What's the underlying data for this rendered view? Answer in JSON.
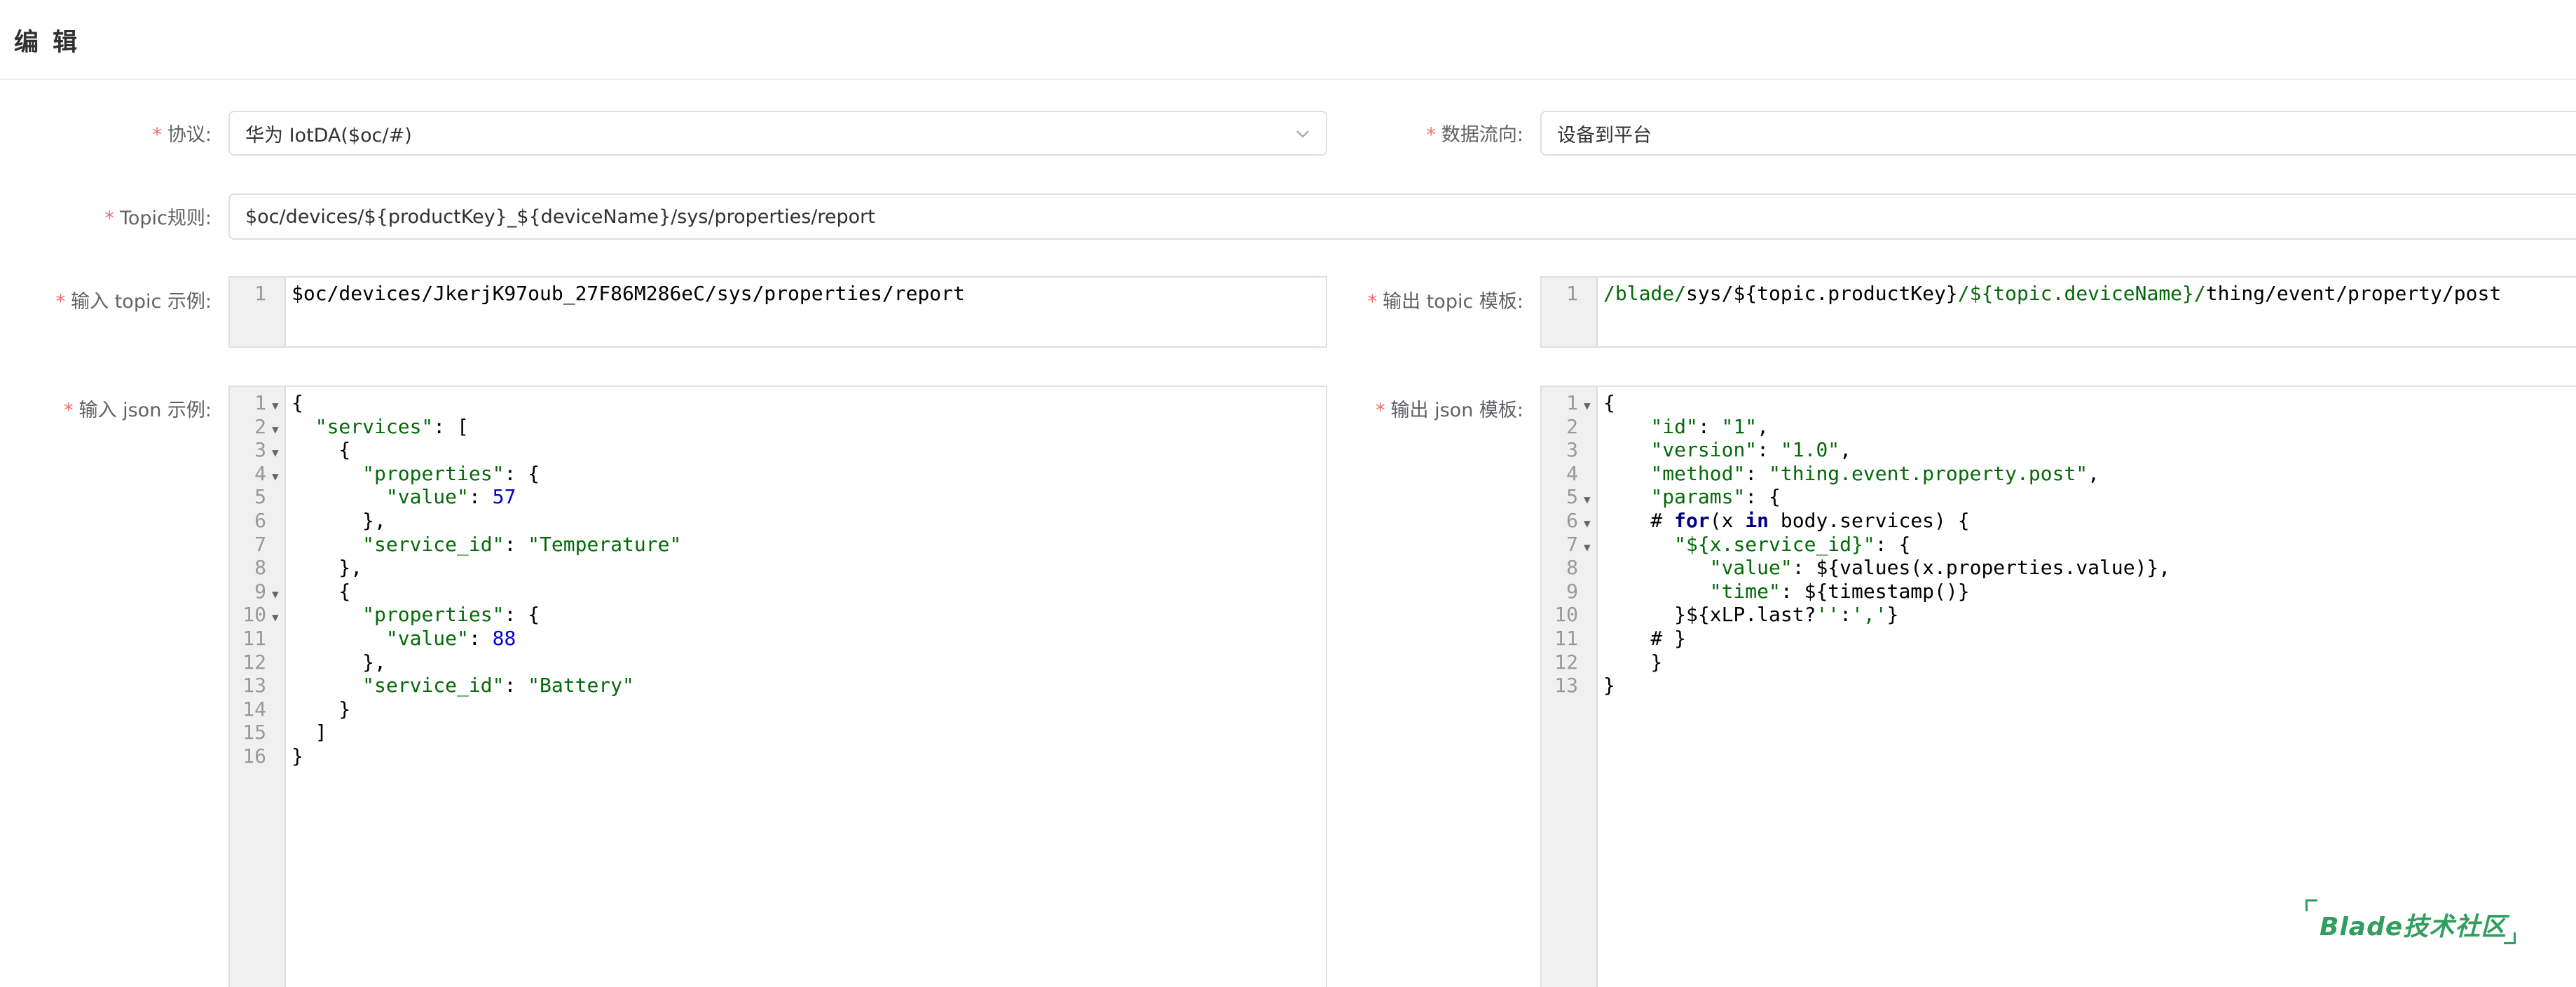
{
  "dialog": {
    "title": "编 辑"
  },
  "form": {
    "protocol": {
      "label": "协议:",
      "value": "华为 IotDA($oc/#)"
    },
    "flow": {
      "label": "数据流向:",
      "value": "设备到平台"
    },
    "topic_rule": {
      "label": "Topic规则:",
      "value": "$oc/devices/${productKey}_${deviceName}/sys/properties/report"
    },
    "input_topic": {
      "label": "输入 topic 示例:",
      "lines": [
        "$oc/devices/JkerjK97oub_27F86M286eC/sys/properties/report"
      ]
    },
    "output_topic": {
      "label": "输出 topic 模板:",
      "lines": [
        "/blade/sys/${topic.productKey}/${topic.deviceName}/thing/event/property/post"
      ]
    },
    "input_json": {
      "label": "输入 json 示例:",
      "lines": [
        "{",
        "  \"services\": [",
        "    {",
        "      \"properties\": {",
        "        \"value\": 57",
        "      },",
        "      \"service_id\": \"Temperature\"",
        "    },",
        "    {",
        "      \"properties\": {",
        "        \"value\": 88",
        "      },",
        "      \"service_id\": \"Battery\"",
        "    }",
        "  ]",
        "}"
      ],
      "fold_lines": [
        1,
        2,
        3,
        4,
        9,
        10
      ]
    },
    "output_json": {
      "label": "输出 json 模板:",
      "lines": [
        "{",
        "    \"id\": \"1\",",
        "    \"version\": \"1.0\",",
        "    \"method\": \"thing.event.property.post\",",
        "    \"params\": {",
        "    # for(x in body.services) {",
        "      \"${x.service_id}\": {",
        "         \"value\": ${values(x.properties.value)},",
        "         \"time\": ${timestamp()}",
        "      }${xLP.last?'':','}",
        "    # }",
        "    }",
        "}"
      ],
      "fold_lines": [
        1,
        5,
        6,
        7
      ]
    }
  },
  "watermark": {
    "text": "Blade技术社区"
  },
  "icons": {
    "select_arrow": "chevron-down-icon",
    "fold_marker": "fold-arrow-icon"
  }
}
